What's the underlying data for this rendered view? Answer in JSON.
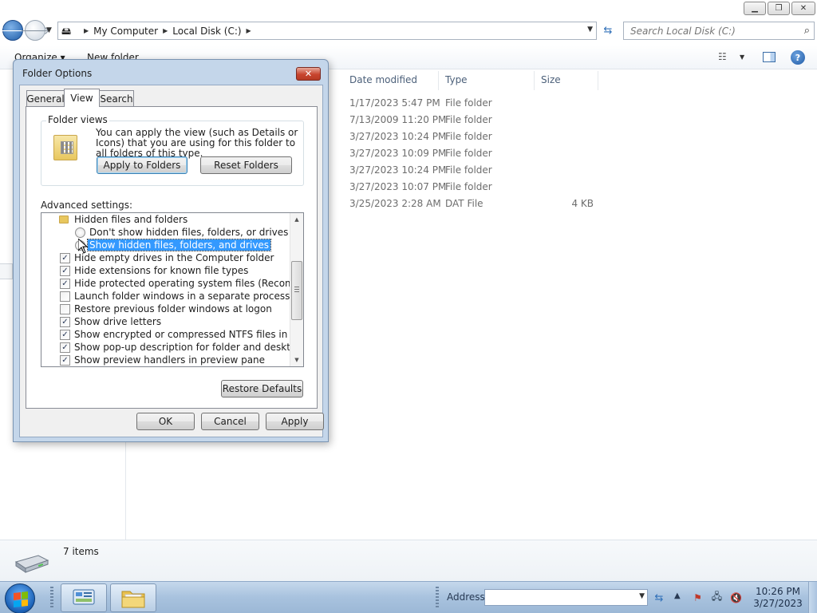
{
  "explorer": {
    "nav": {
      "breadcrumbs": [
        "My Computer",
        "Local Disk (C:)"
      ]
    },
    "search": {
      "placeholder": "Search Local Disk (C:)"
    },
    "toolbar": {
      "organize_label": "Organize ▾",
      "new_folder_label": "New folder"
    },
    "columns": [
      "Date modified",
      "Type",
      "Size"
    ],
    "rows": [
      {
        "date": "1/17/2023 5:47 PM",
        "type": "File folder",
        "size": ""
      },
      {
        "date": "7/13/2009 11:20 PM",
        "type": "File folder",
        "size": ""
      },
      {
        "date": "3/27/2023 10:24 PM",
        "type": "File folder",
        "size": ""
      },
      {
        "date": "3/27/2023 10:09 PM",
        "type": "File folder",
        "size": ""
      },
      {
        "date": "3/27/2023 10:24 PM",
        "type": "File folder",
        "size": ""
      },
      {
        "date": "3/27/2023 10:07 PM",
        "type": "File folder",
        "size": ""
      },
      {
        "date": "3/25/2023 2:28 AM",
        "type": "DAT File",
        "size": "4 KB"
      }
    ],
    "details": {
      "items_count": "7 items"
    }
  },
  "dialog": {
    "title": "Folder Options",
    "close_glyph": "✕",
    "tabs": {
      "general": "General",
      "view": "View",
      "search": "Search"
    },
    "folder_views": {
      "label": "Folder views",
      "description": "You can apply the view (such as Details or Icons) that you are using for this folder to all folders of this type.",
      "apply_label": "Apply to Folders",
      "reset_label": "Reset Folders"
    },
    "advanced_label": "Advanced settings:",
    "advanced": {
      "group_label": "Hidden files and folders",
      "radio_dont_show": "Don't show hidden files, folders, or drives",
      "radio_show": "Show hidden files, folders, and drives",
      "items": [
        {
          "label": "Hide empty drives in the Computer folder",
          "checked": true
        },
        {
          "label": "Hide extensions for known file types",
          "checked": true
        },
        {
          "label": "Hide protected operating system files (Recommended)",
          "checked": true
        },
        {
          "label": "Launch folder windows in a separate process",
          "checked": false
        },
        {
          "label": "Restore previous folder windows at logon",
          "checked": false
        },
        {
          "label": "Show drive letters",
          "checked": true
        },
        {
          "label": "Show encrypted or compressed NTFS files in color",
          "checked": true
        },
        {
          "label": "Show pop-up description for folder and desktop items",
          "checked": true
        },
        {
          "label": "Show preview handlers in preview pane",
          "checked": true
        }
      ]
    },
    "restore_defaults_label": "Restore Defaults",
    "ok_label": "OK",
    "cancel_label": "Cancel",
    "apply_label": "Apply"
  },
  "taskbar": {
    "address_label": "Address",
    "address_value": "",
    "clock_time": "10:26 PM",
    "clock_date": "3/27/2023"
  },
  "colors": {
    "selection": "#3399ff",
    "taskbar": "#a8c2de",
    "dialog_frame": "#c4d6ea"
  },
  "icons": {
    "back": "back-arrow-icon",
    "forward": "forward-arrow-icon",
    "search": "magnifier-icon",
    "help": "help-icon",
    "start": "windows-logo-icon"
  }
}
